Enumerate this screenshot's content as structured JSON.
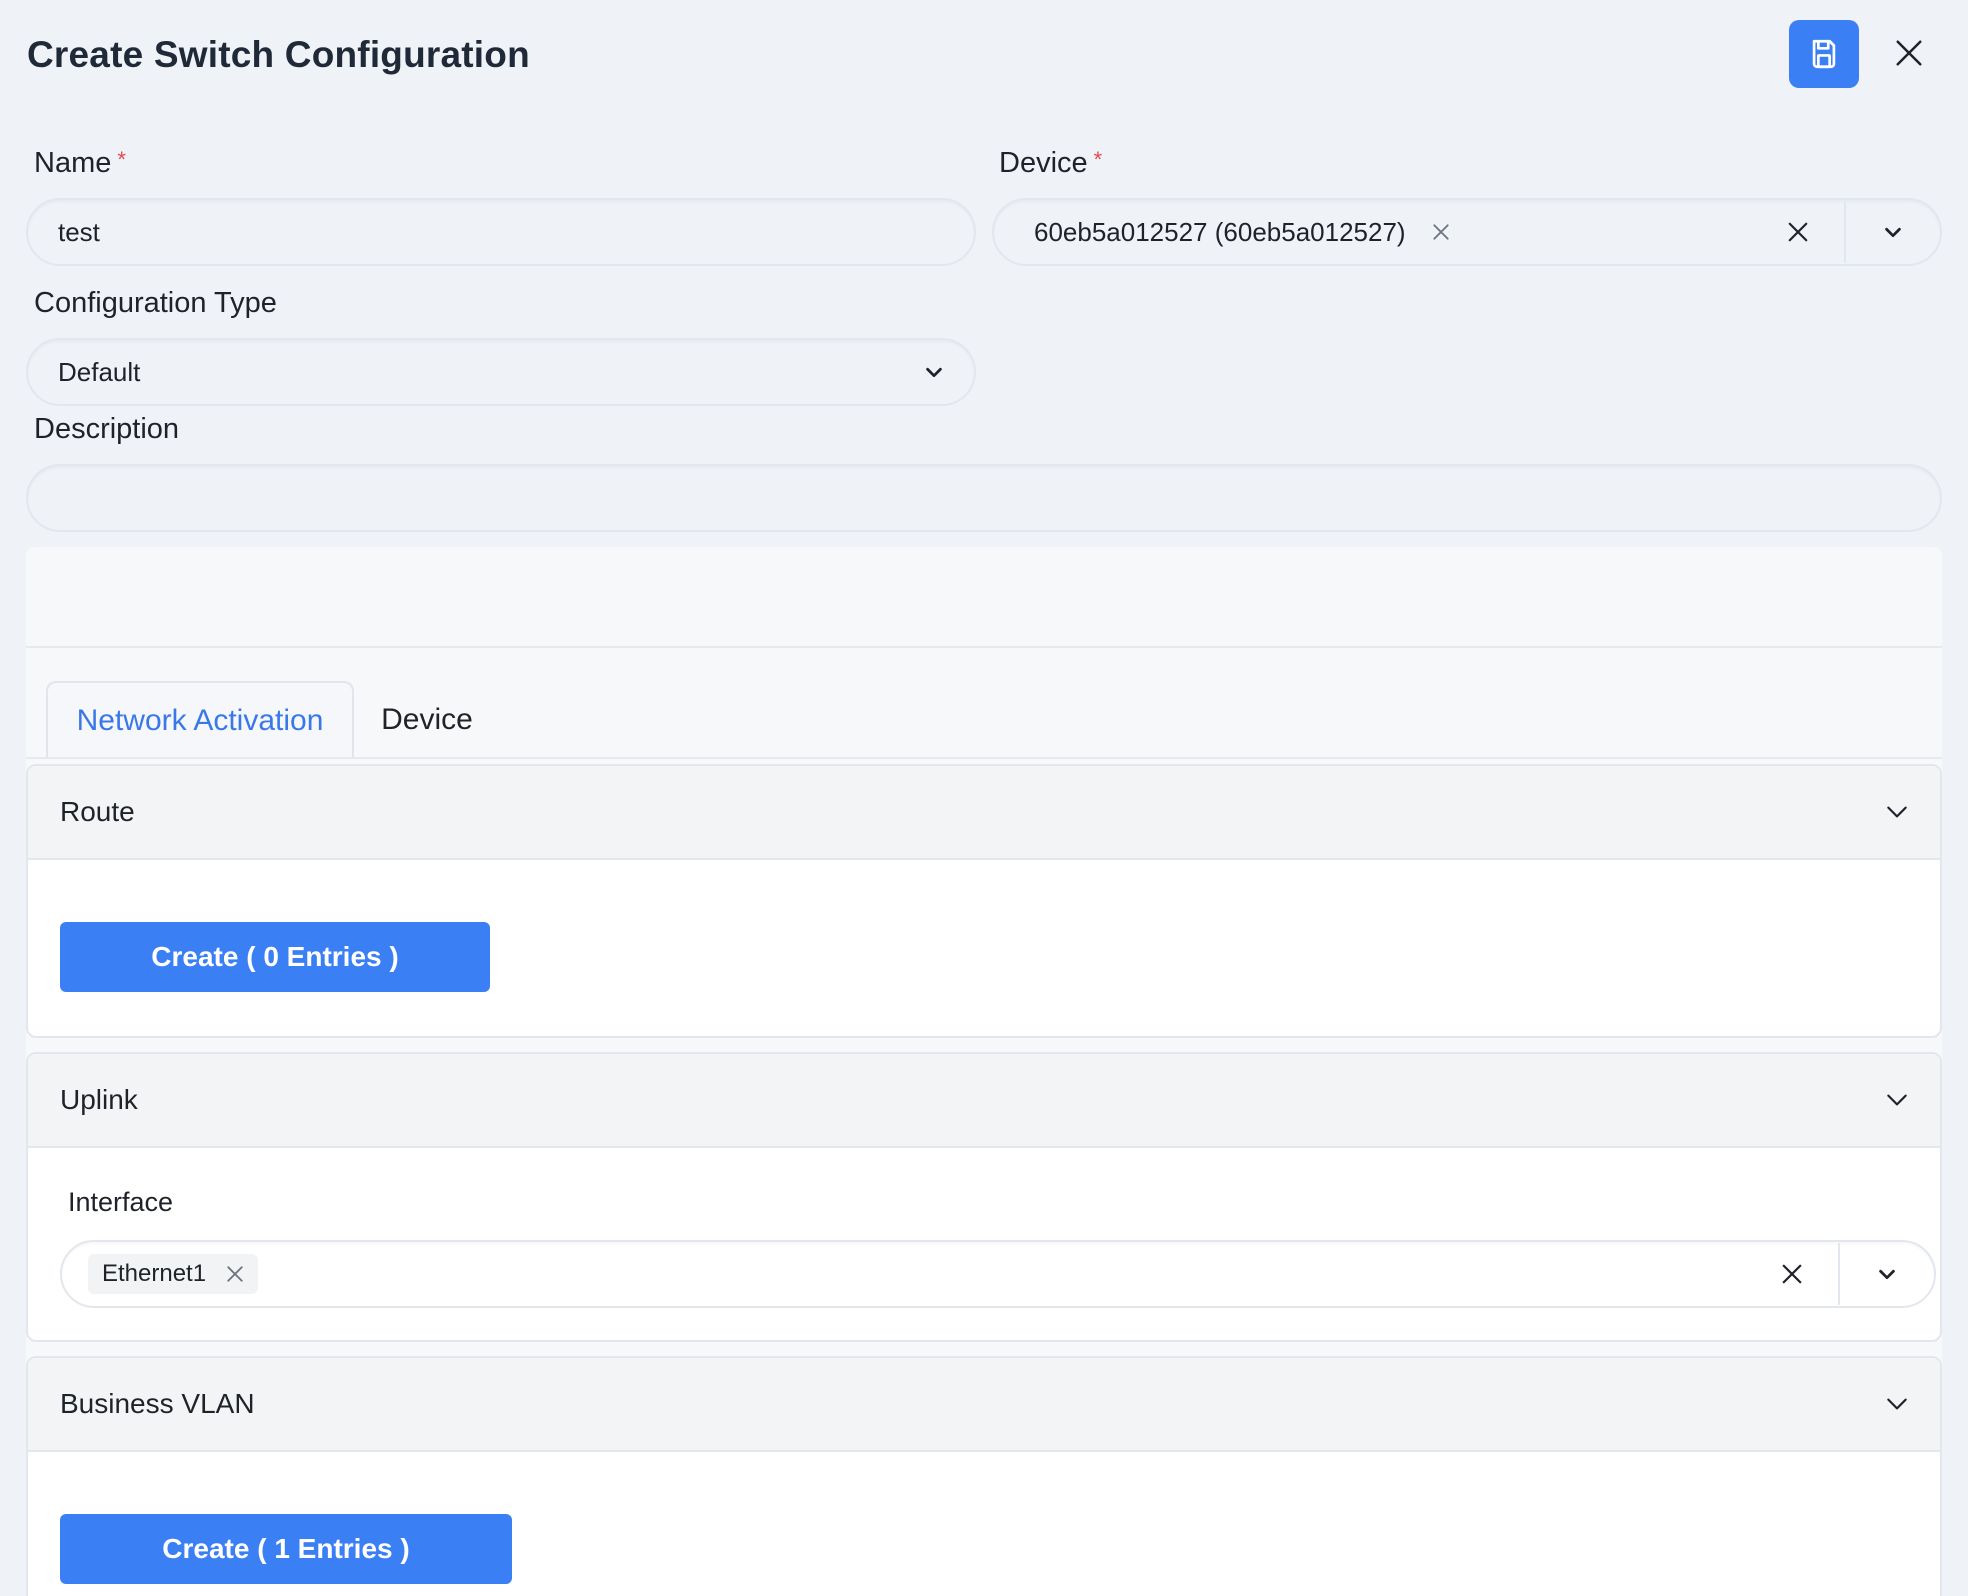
{
  "header": {
    "title": "Create Switch Configuration",
    "save_icon": "save-icon",
    "close_icon": "close-icon"
  },
  "form": {
    "name": {
      "label": "Name",
      "required_mark": "*",
      "value": "test"
    },
    "device": {
      "label": "Device",
      "required_mark": "*",
      "selected": "60eb5a012527 (60eb5a012527)"
    },
    "configuration_type": {
      "label": "Configuration Type",
      "value": "Default"
    },
    "description": {
      "label": "Description",
      "value": ""
    }
  },
  "tabs": [
    {
      "label": "Network Activation",
      "active": true
    },
    {
      "label": "Device",
      "active": false
    }
  ],
  "sections": {
    "route": {
      "title": "Route",
      "button": "Create ( 0 Entries )"
    },
    "uplink": {
      "title": "Uplink",
      "interface_label": "Interface",
      "interface_chip": "Ethernet1"
    },
    "business_vlan": {
      "title": "Business VLAN",
      "button": "Create ( 1 Entries )"
    }
  },
  "colors": {
    "primary": "#3b7ff5",
    "tab_active": "#3a78e8",
    "required": "#e5484d",
    "background": "#eff2f7"
  }
}
